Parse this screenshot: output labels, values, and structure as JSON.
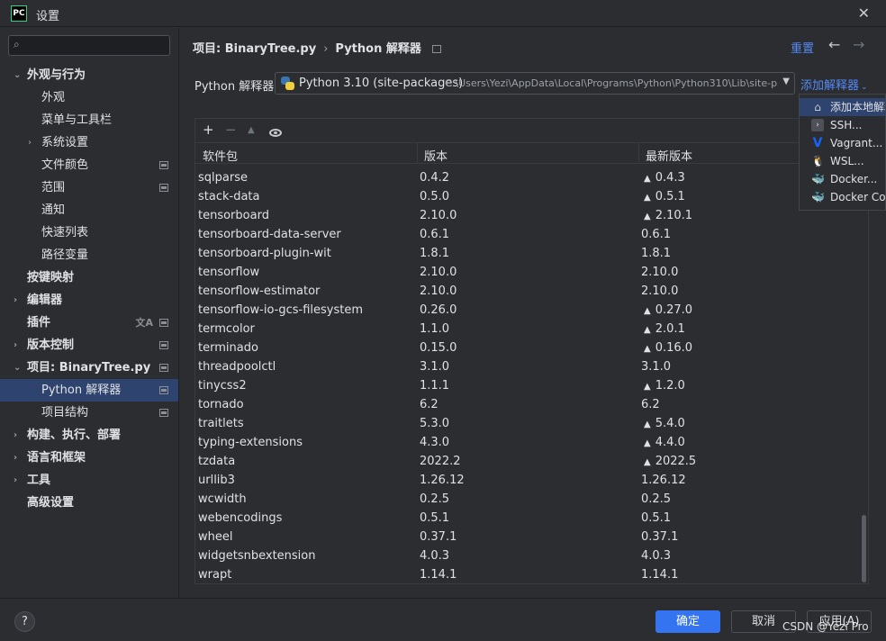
{
  "window": {
    "app_logo": "PC",
    "title": "设置",
    "close_glyph": "✕"
  },
  "search": {
    "placeholder": "",
    "icon_glyph": "⌕"
  },
  "sidebar": {
    "items": [
      {
        "label": "外观与行为",
        "level": 0,
        "chev": "⌄",
        "icon": ""
      },
      {
        "label": "外观",
        "level": 1,
        "chev": "",
        "icon": ""
      },
      {
        "label": "菜单与工具栏",
        "level": 1,
        "chev": "",
        "icon": ""
      },
      {
        "label": "系统设置",
        "level": 1,
        "chev": "›",
        "icon": ""
      },
      {
        "label": "文件颜色",
        "level": 1,
        "chev": "",
        "icon": "project"
      },
      {
        "label": "范围",
        "level": 1,
        "chev": "",
        "icon": "project"
      },
      {
        "label": "通知",
        "level": 1,
        "chev": "",
        "icon": ""
      },
      {
        "label": "快速列表",
        "level": 1,
        "chev": "",
        "icon": ""
      },
      {
        "label": "路径变量",
        "level": 1,
        "chev": "",
        "icon": ""
      },
      {
        "label": "按键映射",
        "level": 0,
        "chev": "",
        "icon": ""
      },
      {
        "label": "编辑器",
        "level": 0,
        "chev": "›",
        "icon": ""
      },
      {
        "label": "插件",
        "level": 0,
        "chev": "",
        "icon": "lang+project"
      },
      {
        "label": "版本控制",
        "level": 0,
        "chev": "›",
        "icon": "project"
      },
      {
        "label": "项目: BinaryTree.py",
        "level": 0,
        "chev": "⌄",
        "icon": "project"
      },
      {
        "label": "Python 解释器",
        "level": 1,
        "chev": "",
        "icon": "project",
        "selected": true
      },
      {
        "label": "项目结构",
        "level": 1,
        "chev": "",
        "icon": "project"
      },
      {
        "label": "构建、执行、部署",
        "level": 0,
        "chev": "›",
        "icon": ""
      },
      {
        "label": "语言和框架",
        "level": 0,
        "chev": "›",
        "icon": ""
      },
      {
        "label": "工具",
        "level": 0,
        "chev": "›",
        "icon": ""
      },
      {
        "label": "高级设置",
        "level": 0,
        "chev": "",
        "icon": ""
      }
    ]
  },
  "header": {
    "crumb_project": "项目: BinaryTree.py",
    "crumb_sep": "›",
    "crumb_page": "Python 解释器",
    "reset": "重置",
    "back": "←",
    "forward": "→"
  },
  "interpreter": {
    "label": "Python 解释器:",
    "name": "Python 3.10 (site-packages)",
    "path": "C:\\Users\\Yezi\\AppData\\Local\\Programs\\Python\\Python310\\Lib\\site-p",
    "arrow": "▼",
    "add_label": "添加解释器",
    "add_caret": "⌄"
  },
  "toolbar": {
    "add": "+",
    "remove": "−",
    "up": "▲"
  },
  "table": {
    "columns": [
      "软件包",
      "版本",
      "最新版本"
    ],
    "rows": [
      {
        "name": "sqlparse",
        "version": "0.4.2",
        "latest": "0.4.3",
        "upgrade": true
      },
      {
        "name": "stack-data",
        "version": "0.5.0",
        "latest": "0.5.1",
        "upgrade": true
      },
      {
        "name": "tensorboard",
        "version": "2.10.0",
        "latest": "2.10.1",
        "upgrade": true
      },
      {
        "name": "tensorboard-data-server",
        "version": "0.6.1",
        "latest": "0.6.1",
        "upgrade": false
      },
      {
        "name": "tensorboard-plugin-wit",
        "version": "1.8.1",
        "latest": "1.8.1",
        "upgrade": false
      },
      {
        "name": "tensorflow",
        "version": "2.10.0",
        "latest": "2.10.0",
        "upgrade": false
      },
      {
        "name": "tensorflow-estimator",
        "version": "2.10.0",
        "latest": "2.10.0",
        "upgrade": false
      },
      {
        "name": "tensorflow-io-gcs-filesystem",
        "version": "0.26.0",
        "latest": "0.27.0",
        "upgrade": true
      },
      {
        "name": "termcolor",
        "version": "1.1.0",
        "latest": "2.0.1",
        "upgrade": true
      },
      {
        "name": "terminado",
        "version": "0.15.0",
        "latest": "0.16.0",
        "upgrade": true
      },
      {
        "name": "threadpoolctl",
        "version": "3.1.0",
        "latest": "3.1.0",
        "upgrade": false
      },
      {
        "name": "tinycss2",
        "version": "1.1.1",
        "latest": "1.2.0",
        "upgrade": true
      },
      {
        "name": "tornado",
        "version": "6.2",
        "latest": "6.2",
        "upgrade": false
      },
      {
        "name": "traitlets",
        "version": "5.3.0",
        "latest": "5.4.0",
        "upgrade": true
      },
      {
        "name": "typing-extensions",
        "version": "4.3.0",
        "latest": "4.4.0",
        "upgrade": true
      },
      {
        "name": "tzdata",
        "version": "2022.2",
        "latest": "2022.5",
        "upgrade": true
      },
      {
        "name": "urllib3",
        "version": "1.26.12",
        "latest": "1.26.12",
        "upgrade": false
      },
      {
        "name": "wcwidth",
        "version": "0.2.5",
        "latest": "0.2.5",
        "upgrade": false
      },
      {
        "name": "webencodings",
        "version": "0.5.1",
        "latest": "0.5.1",
        "upgrade": false
      },
      {
        "name": "wheel",
        "version": "0.37.1",
        "latest": "0.37.1",
        "upgrade": false
      },
      {
        "name": "widgetsnbextension",
        "version": "4.0.3",
        "latest": "4.0.3",
        "upgrade": false
      },
      {
        "name": "wrapt",
        "version": "1.14.1",
        "latest": "1.14.1",
        "upgrade": false
      }
    ]
  },
  "popup": {
    "items": [
      {
        "label": "添加本地解释器",
        "icon": "home-icon",
        "glyph": "⌂",
        "highlighted": true
      },
      {
        "label": "SSH...",
        "icon": "terminal-icon",
        "glyph": "›",
        "highlighted": false
      },
      {
        "label": "Vagrant...",
        "icon": "vagrant-icon",
        "glyph": "V",
        "highlighted": false
      },
      {
        "label": "WSL...",
        "icon": "linux-icon",
        "glyph": "🐧",
        "highlighted": false
      },
      {
        "label": "Docker...",
        "icon": "docker-icon",
        "glyph": "🐳",
        "highlighted": false
      },
      {
        "label": "Docker Compose...",
        "icon": "docker-icon",
        "glyph": "🐳",
        "highlighted": false
      }
    ]
  },
  "footer": {
    "help": "?",
    "ok": "确定",
    "cancel": "取消",
    "apply": "应用(A)",
    "watermark": "CSDN @Yezi Pro"
  },
  "colors": {
    "accent": "#3574f0",
    "link": "#548af7",
    "selection": "#2e436e",
    "background": "#2b2d30"
  }
}
